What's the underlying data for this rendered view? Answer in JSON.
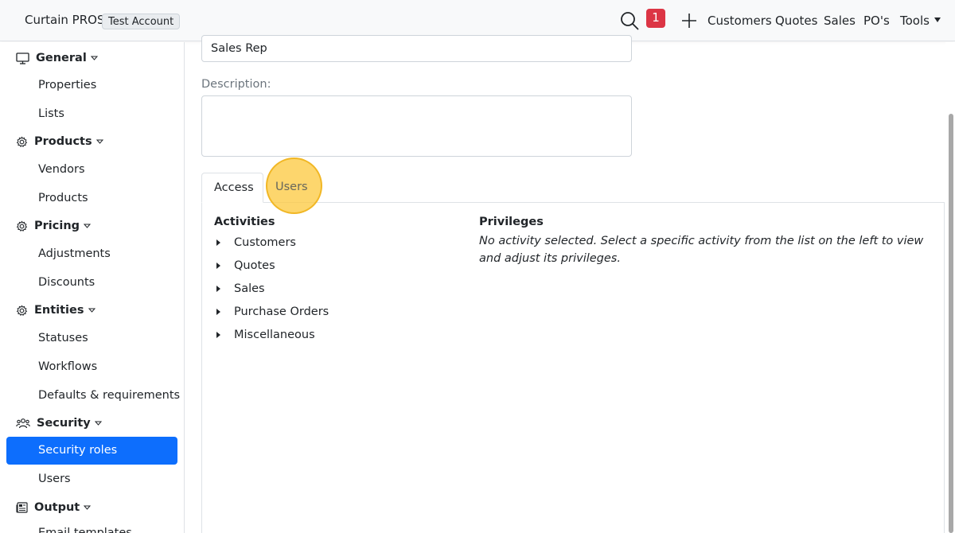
{
  "header": {
    "brand": "Curtain PROS",
    "account_badge": "Test Account",
    "notification_count": "1",
    "nav": [
      "Customers",
      "Quotes",
      "Sales",
      "PO's",
      "Tools"
    ]
  },
  "sidebar": {
    "sections": [
      {
        "label": "General",
        "icon": "monitor-icon",
        "items": [
          "Properties",
          "Lists"
        ]
      },
      {
        "label": "Products",
        "icon": "gear-icon",
        "items": [
          "Vendors",
          "Products"
        ]
      },
      {
        "label": "Pricing",
        "icon": "gear-icon",
        "items": [
          "Adjustments",
          "Discounts"
        ]
      },
      {
        "label": "Entities",
        "icon": "gear-icon",
        "items": [
          "Statuses",
          "Workflows",
          "Defaults & requirements"
        ]
      },
      {
        "label": "Security",
        "icon": "users-icon",
        "items": [
          "Security roles",
          "Users"
        ]
      },
      {
        "label": "Output",
        "icon": "newspaper-icon",
        "items": [
          "Email templates"
        ]
      }
    ],
    "active_item": "Security roles"
  },
  "form": {
    "name_value": "Sales Rep",
    "description_label": "Description:",
    "description_value": ""
  },
  "tabs": {
    "access": "Access",
    "users": "Users",
    "active": "Access"
  },
  "access": {
    "activities_title": "Activities",
    "activities": [
      "Customers",
      "Quotes",
      "Sales",
      "Purchase Orders",
      "Miscellaneous"
    ],
    "privileges_title": "Privileges",
    "privileges_text": "No activity selected. Select a specific activity from the list on the left to view and adjust its privileges."
  },
  "colors": {
    "accent": "#0d6efd",
    "badge": "#dc3545",
    "highlight": "#fcc83c"
  }
}
